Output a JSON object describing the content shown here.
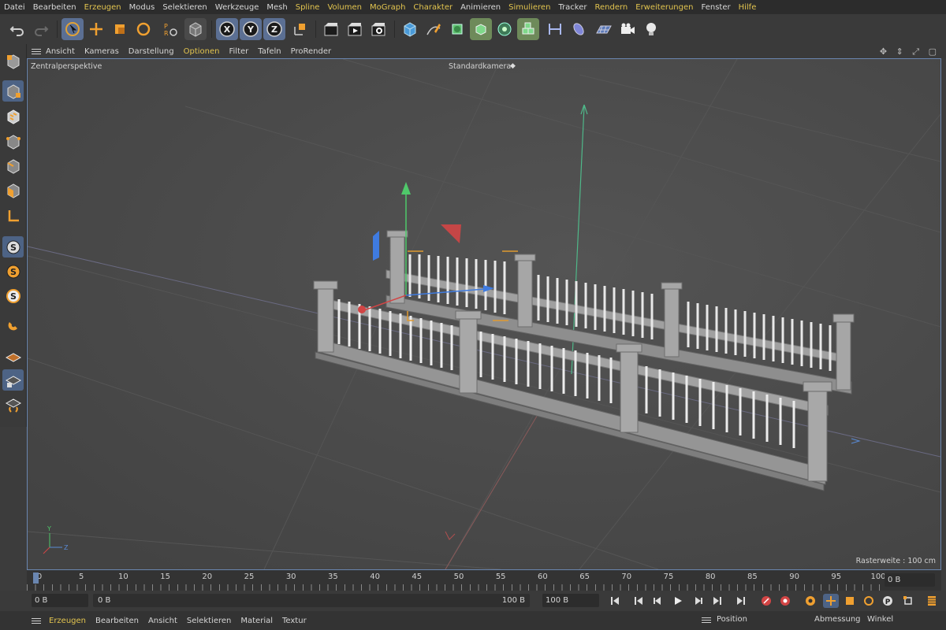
{
  "menu": {
    "items": [
      {
        "label": "Datei",
        "accent": false
      },
      {
        "label": "Bearbeiten",
        "accent": false
      },
      {
        "label": "Erzeugen",
        "accent": true
      },
      {
        "label": "Modus",
        "accent": false
      },
      {
        "label": "Selektieren",
        "accent": false
      },
      {
        "label": "Werkzeuge",
        "accent": false
      },
      {
        "label": "Mesh",
        "accent": false
      },
      {
        "label": "Spline",
        "accent": true
      },
      {
        "label": "Volumen",
        "accent": true
      },
      {
        "label": "MoGraph",
        "accent": true
      },
      {
        "label": "Charakter",
        "accent": true
      },
      {
        "label": "Animieren",
        "accent": false
      },
      {
        "label": "Simulieren",
        "accent": true
      },
      {
        "label": "Tracker",
        "accent": false
      },
      {
        "label": "Rendern",
        "accent": true
      },
      {
        "label": "Erweiterungen",
        "accent": true
      },
      {
        "label": "Fenster",
        "accent": false
      },
      {
        "label": "Hilfe",
        "accent": true
      }
    ]
  },
  "toolbar": {
    "axis_x": "X",
    "axis_y": "Y",
    "axis_z": "Z"
  },
  "viewport_menu": {
    "items": [
      {
        "label": "Ansicht",
        "accent": false
      },
      {
        "label": "Kameras",
        "accent": false
      },
      {
        "label": "Darstellung",
        "accent": false
      },
      {
        "label": "Optionen",
        "accent": true
      },
      {
        "label": "Filter",
        "accent": false
      },
      {
        "label": "Tafeln",
        "accent": false
      },
      {
        "label": "ProRender",
        "accent": false
      }
    ]
  },
  "viewport": {
    "perspective_label": "Zentralperspektive",
    "camera_label": "Standardkamera",
    "grid_label": "Rasterweite : 100 cm",
    "axis_y": "Y",
    "axis_z": "Z"
  },
  "timeline": {
    "ticks": [
      "0",
      "5",
      "10",
      "15",
      "20",
      "25",
      "30",
      "35",
      "40",
      "45",
      "50",
      "55",
      "60",
      "65",
      "70",
      "75",
      "80",
      "85",
      "90",
      "95",
      "100"
    ],
    "current_frame": "0 B"
  },
  "transport": {
    "start_field": "0 B",
    "range_start": "0 B",
    "range_end": "100 B",
    "end_field": "100 B"
  },
  "bottom_bar": {
    "left_items": [
      {
        "label": "Erzeugen",
        "accent": true
      },
      {
        "label": "Bearbeiten",
        "accent": false
      },
      {
        "label": "Ansicht",
        "accent": false
      },
      {
        "label": "Selektieren",
        "accent": false
      },
      {
        "label": "Material",
        "accent": false
      },
      {
        "label": "Textur",
        "accent": false
      }
    ],
    "position_label": "Position",
    "size_label": "Abmessung",
    "angle_label": "Winkel"
  },
  "colors": {
    "accent_yellow": "#e2c44f",
    "selection_blue": "#6a86b0",
    "viewport_bg": "#4a4a4a"
  }
}
